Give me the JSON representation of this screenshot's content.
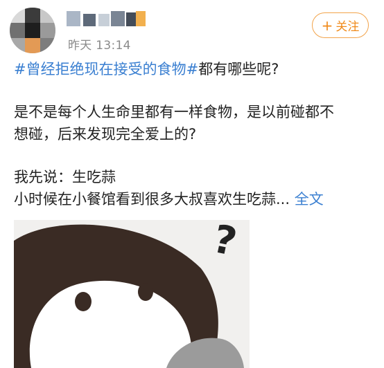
{
  "header": {
    "timestamp": "昨天 13:14",
    "follow_label": "关注",
    "follow_plus": "+"
  },
  "post": {
    "hashtag": "#曾经拒绝现在接受的食物#",
    "title_rest": "都有哪些呢?",
    "paragraph1_line1": "是不是每个人生命里都有一样食物，是以前碰都不",
    "paragraph1_line2": "想碰，后来发现完全爱上的?",
    "line_first": "我先说：生吃蒜",
    "line_second": "小时候在小餐馆看到很多大叔喜欢生吃蒜...",
    "full_text_link": "全文"
  },
  "image": {
    "icon": "penguin-question-meme",
    "overlay_char": "?"
  }
}
